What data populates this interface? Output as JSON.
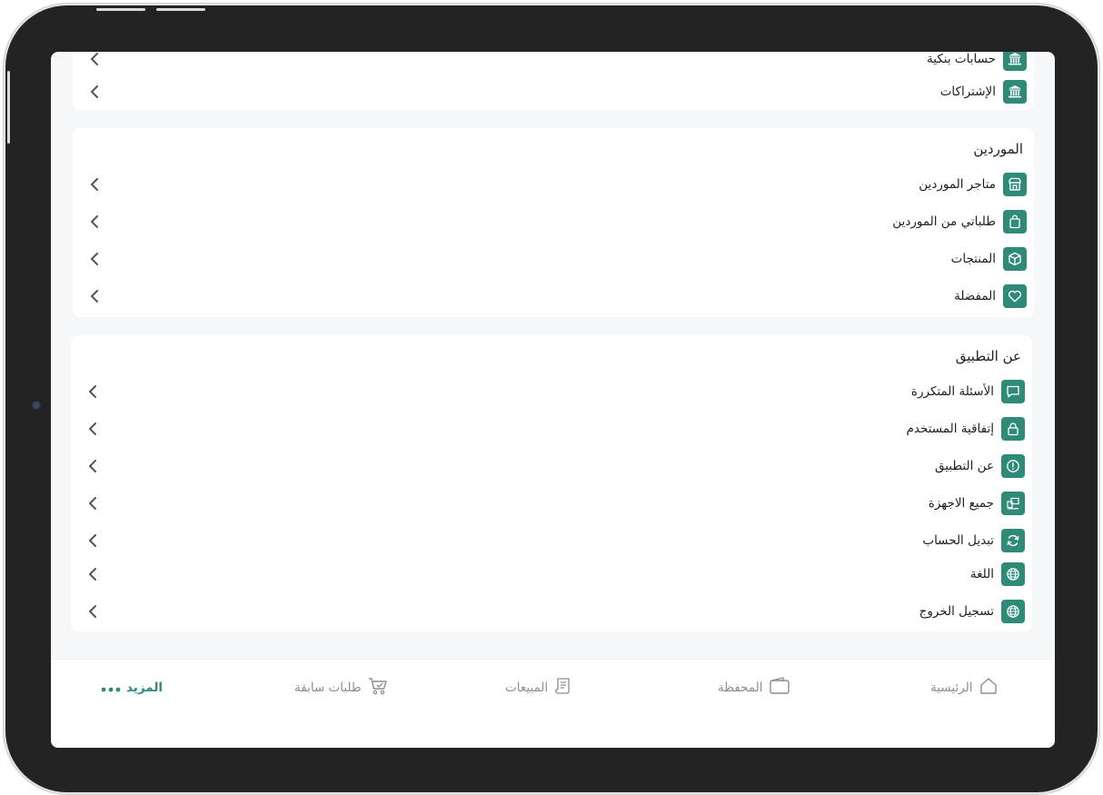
{
  "colors": {
    "accent": "#2f8a78",
    "muted": "#8d8d8d",
    "text": "#1e1e1e"
  },
  "top_section": {
    "items": [
      {
        "label": "حسابات بنكية",
        "icon": "bank-icon"
      },
      {
        "label": "الإشتراكات",
        "icon": "bank-icon"
      }
    ]
  },
  "suppliers": {
    "title": "الموردين",
    "items": [
      {
        "label": "متاجر الموردين",
        "icon": "store-icon"
      },
      {
        "label": "طلباتي من الموردين",
        "icon": "bag-icon"
      },
      {
        "label": "المنتجات",
        "icon": "box-icon"
      },
      {
        "label": "المفضلة",
        "icon": "heart-icon"
      }
    ]
  },
  "about": {
    "title": "عن التطبيق",
    "items": [
      {
        "label": "الأسئلة المتكررة",
        "icon": "chat-icon"
      },
      {
        "label": "إتفاقية المستخدم",
        "icon": "lock-icon"
      },
      {
        "label": "عن التطبيق",
        "icon": "info-icon"
      },
      {
        "label": "جميع الاجهزة",
        "icon": "devices-icon"
      },
      {
        "label": "تبديل الحساب",
        "icon": "refresh-icon"
      },
      {
        "label": "اللغة",
        "icon": "globe-icon"
      },
      {
        "label": "تسجيل الخروج",
        "icon": "globe-icon"
      }
    ]
  },
  "tabbar": {
    "home": "الرئيسية",
    "wallet": "المحفظة",
    "sales": "المبيعات",
    "orders": "طلبات سابقة",
    "more": "المزيد"
  }
}
